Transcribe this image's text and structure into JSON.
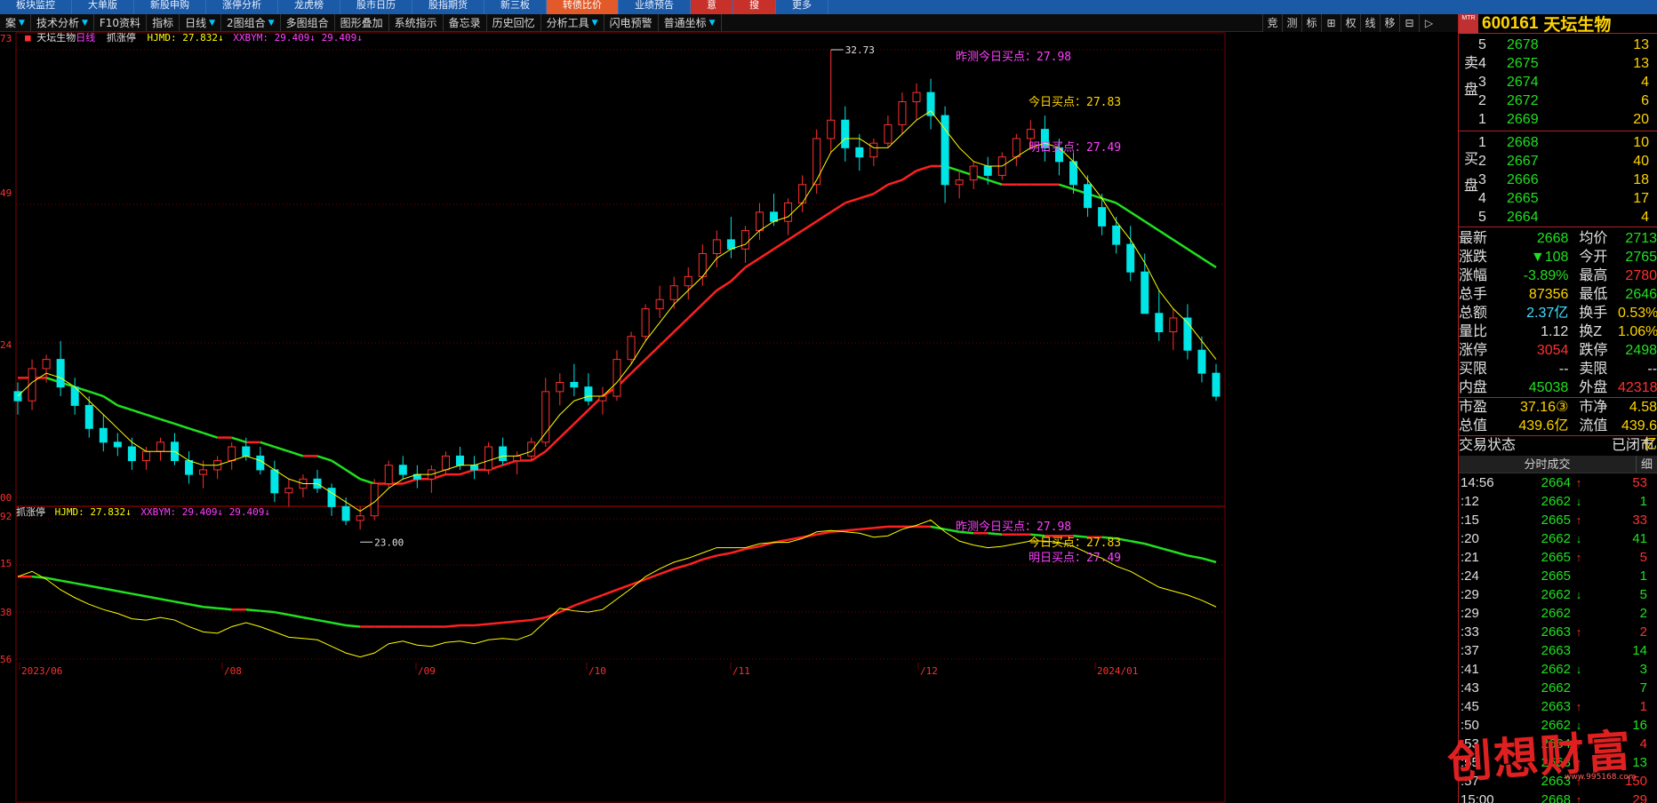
{
  "topmenu": [
    {
      "label": "板块监控",
      "hl": ""
    },
    {
      "label": "大单版",
      "hl": ""
    },
    {
      "label": "新股申购",
      "hl": ""
    },
    {
      "label": "涨停分析",
      "hl": ""
    },
    {
      "label": "龙虎榜",
      "hl": ""
    },
    {
      "label": "股市日历",
      "hl": ""
    },
    {
      "label": "股指期货",
      "hl": ""
    },
    {
      "label": "新三板",
      "hl": ""
    },
    {
      "label": "转债比价",
      "hl": "hl"
    },
    {
      "label": "业绩预告",
      "hl": ""
    },
    {
      "label": "意",
      "hl": "hl2"
    },
    {
      "label": "搜",
      "hl": "hl2"
    },
    {
      "label": "更多",
      "hl": ""
    }
  ],
  "toolbar": [
    {
      "label": "案",
      "dd": "▼"
    },
    {
      "label": "技术分析",
      "dd": "▼"
    },
    {
      "label": "F10资料",
      "dd": ""
    },
    {
      "label": "指标",
      "dd": ""
    },
    {
      "label": "日线",
      "dd": "▼"
    },
    {
      "label": "2图组合",
      "dd": "▼"
    },
    {
      "label": "多图组合",
      "dd": ""
    },
    {
      "label": "图形叠加",
      "dd": ""
    },
    {
      "label": "系统指示",
      "dd": ""
    },
    {
      "label": "备忘录",
      "dd": ""
    },
    {
      "label": "历史回忆",
      "dd": ""
    },
    {
      "label": "分析工具",
      "dd": "▼"
    },
    {
      "label": "闪电预警",
      "dd": ""
    },
    {
      "label": "普通坐标",
      "dd": "▼"
    }
  ],
  "rtools": [
    "竞",
    "测",
    "标",
    "⊞",
    "权",
    "线",
    "移",
    "⊟",
    "▷"
  ],
  "colors": {
    "up": "#ff3030",
    "down": "#00e5e5",
    "ma": "#ffff00",
    "pink": "#ff40ff",
    "green": "#20e020",
    "red": "#ff2020",
    "grid": "#7a0000",
    "price_text": "#20e020"
  },
  "main_info": {
    "name": "天坛生物",
    "period": "日线",
    "ind": "抓涨停",
    "hjmd": "HJMD: 27.832↓",
    "xxbym": "XXBYM: 29.409↓",
    "xxbym2": "29.409↓"
  },
  "sub_info": {
    "ind": "抓涨停",
    "hjmd": "HJMD: 27.832↓",
    "xxbym": "XXBYM: 29.409↓",
    "xxbym2": "29.409↓"
  },
  "annotations": {
    "max_label": "32.73",
    "min_label": "23.00",
    "buy_yday": "昨测今日买点：27.98",
    "buy_today": "今日买点：27.83",
    "buy_tomorrow": "明日买点：27.49"
  },
  "y_labels_main": [
    "73",
    "49",
    "24",
    "00"
  ],
  "y_labels_sub": [
    "92",
    "15",
    "38",
    "56"
  ],
  "x_labels": [
    "2023/06",
    "/08",
    "/09",
    "/10",
    "/11",
    "/12",
    "2024/01"
  ],
  "chart_data": {
    "type": "candlestick",
    "ylim": [
      23.0,
      32.73
    ],
    "candles": [
      [
        25.3,
        25.5,
        24.8,
        25.1
      ],
      [
        25.1,
        26.0,
        24.9,
        25.8
      ],
      [
        25.8,
        26.1,
        25.5,
        26.0
      ],
      [
        26.0,
        26.4,
        25.2,
        25.4
      ],
      [
        25.4,
        25.6,
        24.8,
        25.0
      ],
      [
        25.0,
        25.2,
        24.3,
        24.5
      ],
      [
        24.5,
        24.8,
        24.0,
        24.2
      ],
      [
        24.2,
        24.4,
        23.9,
        24.1
      ],
      [
        24.1,
        24.3,
        23.6,
        23.8
      ],
      [
        23.8,
        24.1,
        23.6,
        24.0
      ],
      [
        24.0,
        24.3,
        23.8,
        24.2
      ],
      [
        24.2,
        24.4,
        23.7,
        23.8
      ],
      [
        23.8,
        24.0,
        23.3,
        23.5
      ],
      [
        23.5,
        23.8,
        23.2,
        23.6
      ],
      [
        23.6,
        23.9,
        23.4,
        23.8
      ],
      [
        23.8,
        24.2,
        23.6,
        24.1
      ],
      [
        24.1,
        24.3,
        23.8,
        23.9
      ],
      [
        23.9,
        24.1,
        23.5,
        23.6
      ],
      [
        23.6,
        23.8,
        22.9,
        23.1
      ],
      [
        23.1,
        23.4,
        22.8,
        23.2
      ],
      [
        23.2,
        23.5,
        23.0,
        23.4
      ],
      [
        23.4,
        23.6,
        23.1,
        23.2
      ],
      [
        23.2,
        23.3,
        22.6,
        22.8
      ],
      [
        22.8,
        23.0,
        22.4,
        22.5
      ],
      [
        22.5,
        22.8,
        22.3,
        22.6
      ],
      [
        22.6,
        23.4,
        22.5,
        23.3
      ],
      [
        23.3,
        23.8,
        23.2,
        23.7
      ],
      [
        23.7,
        23.9,
        23.4,
        23.5
      ],
      [
        23.5,
        23.7,
        23.2,
        23.4
      ],
      [
        23.4,
        23.7,
        23.1,
        23.6
      ],
      [
        23.6,
        24.0,
        23.5,
        23.9
      ],
      [
        23.9,
        24.1,
        23.6,
        23.7
      ],
      [
        23.7,
        23.9,
        23.4,
        23.6
      ],
      [
        23.6,
        24.2,
        23.5,
        24.1
      ],
      [
        24.1,
        24.3,
        23.7,
        23.8
      ],
      [
        23.8,
        24.0,
        23.5,
        23.9
      ],
      [
        23.9,
        24.3,
        23.8,
        24.2
      ],
      [
        24.2,
        25.6,
        24.1,
        25.3
      ],
      [
        25.3,
        25.7,
        25.0,
        25.5
      ],
      [
        25.5,
        25.9,
        25.2,
        25.4
      ],
      [
        25.4,
        25.7,
        25.0,
        25.1
      ],
      [
        25.1,
        25.4,
        24.8,
        25.2
      ],
      [
        25.2,
        26.2,
        25.1,
        26.0
      ],
      [
        26.0,
        26.6,
        25.9,
        26.5
      ],
      [
        26.5,
        27.2,
        26.4,
        27.1
      ],
      [
        27.1,
        27.6,
        26.9,
        27.3
      ],
      [
        27.3,
        27.8,
        27.1,
        27.6
      ],
      [
        27.6,
        28.0,
        27.3,
        27.8
      ],
      [
        27.8,
        28.5,
        27.6,
        28.3
      ],
      [
        28.3,
        28.8,
        28.0,
        28.6
      ],
      [
        28.6,
        29.1,
        28.2,
        28.4
      ],
      [
        28.4,
        28.9,
        28.1,
        28.8
      ],
      [
        28.8,
        29.4,
        28.6,
        29.2
      ],
      [
        29.2,
        29.6,
        28.9,
        29.0
      ],
      [
        29.0,
        29.5,
        28.7,
        29.4
      ],
      [
        29.4,
        30.0,
        29.2,
        29.8
      ],
      [
        29.8,
        31.0,
        29.6,
        30.8
      ],
      [
        30.8,
        32.73,
        30.5,
        31.2
      ],
      [
        31.2,
        31.5,
        30.3,
        30.6
      ],
      [
        30.6,
        30.9,
        30.1,
        30.4
      ],
      [
        30.4,
        30.8,
        30.2,
        30.7
      ],
      [
        30.7,
        31.3,
        30.6,
        31.1
      ],
      [
        31.1,
        31.8,
        30.9,
        31.6
      ],
      [
        31.6,
        32.0,
        31.2,
        31.8
      ],
      [
        31.8,
        32.1,
        31.0,
        31.3
      ],
      [
        31.3,
        31.5,
        29.4,
        29.8
      ],
      [
        29.8,
        30.1,
        29.5,
        29.9
      ],
      [
        29.9,
        30.3,
        29.7,
        30.2
      ],
      [
        30.2,
        30.4,
        29.8,
        30.0
      ],
      [
        30.0,
        30.5,
        29.9,
        30.4
      ],
      [
        30.4,
        30.9,
        30.2,
        30.8
      ],
      [
        30.8,
        31.2,
        30.6,
        31.0
      ],
      [
        31.0,
        31.3,
        30.3,
        30.6
      ],
      [
        30.6,
        30.8,
        30.0,
        30.3
      ],
      [
        30.3,
        30.5,
        29.6,
        29.8
      ],
      [
        29.8,
        30.0,
        29.1,
        29.3
      ],
      [
        29.3,
        29.6,
        28.7,
        28.9
      ],
      [
        28.9,
        29.1,
        28.3,
        28.5
      ],
      [
        28.5,
        28.9,
        27.7,
        27.9
      ],
      [
        27.9,
        28.3,
        27.2,
        27.0
      ],
      [
        27.0,
        27.5,
        26.4,
        26.6
      ],
      [
        26.6,
        27.1,
        26.2,
        26.9
      ],
      [
        26.9,
        27.2,
        26.0,
        26.2
      ],
      [
        26.2,
        26.5,
        25.5,
        25.7
      ],
      [
        25.7,
        25.9,
        25.1,
        25.2
      ]
    ],
    "ma": [
      25.2,
      25.5,
      25.7,
      25.6,
      25.4,
      25.1,
      24.8,
      24.5,
      24.2,
      24.0,
      24.0,
      24.0,
      23.8,
      23.7,
      23.7,
      23.8,
      23.9,
      23.8,
      23.6,
      23.4,
      23.3,
      23.3,
      23.1,
      22.9,
      22.7,
      22.9,
      23.2,
      23.4,
      23.5,
      23.5,
      23.6,
      23.7,
      23.7,
      23.8,
      23.9,
      23.9,
      24.0,
      24.4,
      24.8,
      25.1,
      25.2,
      25.2,
      25.5,
      25.9,
      26.4,
      26.8,
      27.2,
      27.5,
      27.8,
      28.2,
      28.4,
      28.5,
      28.8,
      29.0,
      29.1,
      29.4,
      29.9,
      30.5,
      30.8,
      30.8,
      30.6,
      30.6,
      30.9,
      31.2,
      31.4,
      31.0,
      30.6,
      30.3,
      30.2,
      30.2,
      30.4,
      30.6,
      30.7,
      30.6,
      30.3,
      29.9,
      29.5,
      29.0,
      28.6,
      28.1,
      27.5,
      27.1,
      26.8,
      26.4,
      26.0
    ],
    "line_slow": [
      25.6,
      25.6,
      25.6,
      25.5,
      25.4,
      25.3,
      25.2,
      25.0,
      24.9,
      24.8,
      24.7,
      24.6,
      24.5,
      24.4,
      24.3,
      24.3,
      24.2,
      24.2,
      24.1,
      24.0,
      23.9,
      23.9,
      23.8,
      23.6,
      23.4,
      23.3,
      23.3,
      23.3,
      23.4,
      23.4,
      23.5,
      23.5,
      23.6,
      23.6,
      23.7,
      23.8,
      23.8,
      24.0,
      24.3,
      24.6,
      24.9,
      25.2,
      25.4,
      25.7,
      26.0,
      26.3,
      26.6,
      26.9,
      27.2,
      27.5,
      27.7,
      28.0,
      28.2,
      28.4,
      28.6,
      28.8,
      29.0,
      29.2,
      29.4,
      29.5,
      29.6,
      29.8,
      29.9,
      30.1,
      30.2,
      30.2,
      30.1,
      30.0,
      29.9,
      29.8,
      29.8,
      29.8,
      29.8,
      29.8,
      29.7,
      29.6,
      29.5,
      29.4,
      29.2,
      29.0,
      28.8,
      28.6,
      28.4,
      28.2,
      28.0
    ],
    "sub_yellow": [
      0.66,
      0.7,
      0.64,
      0.56,
      0.5,
      0.45,
      0.41,
      0.38,
      0.34,
      0.33,
      0.35,
      0.33,
      0.28,
      0.24,
      0.23,
      0.28,
      0.31,
      0.28,
      0.24,
      0.2,
      0.19,
      0.18,
      0.13,
      0.08,
      0.05,
      0.08,
      0.15,
      0.17,
      0.14,
      0.13,
      0.16,
      0.17,
      0.15,
      0.18,
      0.19,
      0.18,
      0.22,
      0.32,
      0.42,
      0.4,
      0.39,
      0.41,
      0.49,
      0.57,
      0.66,
      0.72,
      0.77,
      0.8,
      0.84,
      0.88,
      0.88,
      0.88,
      0.91,
      0.92,
      0.92,
      0.95,
      1.0,
      1.01,
      1.0,
      0.99,
      0.96,
      0.97,
      1.02,
      1.05,
      1.09,
      1.0,
      0.93,
      0.9,
      0.88,
      0.89,
      0.91,
      0.93,
      0.93,
      0.92,
      0.89,
      0.84,
      0.8,
      0.74,
      0.7,
      0.64,
      0.58,
      0.55,
      0.52,
      0.48,
      0.43
    ],
    "sub_trend": [
      0.66,
      0.66,
      0.65,
      0.63,
      0.61,
      0.59,
      0.57,
      0.55,
      0.53,
      0.51,
      0.49,
      0.47,
      0.45,
      0.43,
      0.42,
      0.41,
      0.41,
      0.4,
      0.39,
      0.37,
      0.35,
      0.33,
      0.31,
      0.29,
      0.28,
      0.28,
      0.28,
      0.28,
      0.28,
      0.28,
      0.28,
      0.29,
      0.29,
      0.3,
      0.31,
      0.32,
      0.33,
      0.35,
      0.39,
      0.44,
      0.48,
      0.52,
      0.56,
      0.6,
      0.64,
      0.68,
      0.72,
      0.75,
      0.79,
      0.82,
      0.84,
      0.87,
      0.89,
      0.92,
      0.94,
      0.96,
      0.98,
      1.0,
      1.01,
      1.02,
      1.03,
      1.04,
      1.04,
      1.04,
      1.04,
      1.02,
      1.0,
      0.99,
      0.99,
      0.98,
      0.98,
      0.98,
      0.97,
      0.97,
      0.97,
      0.96,
      0.96,
      0.95,
      0.93,
      0.91,
      0.88,
      0.85,
      0.82,
      0.8,
      0.77
    ]
  },
  "stock": {
    "code": "600161",
    "name": "天坛生物",
    "mtr": "MTR"
  },
  "sell_side": "卖盘",
  "buy_side": "买盘",
  "sells": [
    {
      "lv": "5",
      "px": "2678",
      "vol": "13"
    },
    {
      "lv": "4",
      "px": "2675",
      "vol": "13"
    },
    {
      "lv": "3",
      "px": "2674",
      "vol": "4"
    },
    {
      "lv": "2",
      "px": "2672",
      "vol": "6"
    },
    {
      "lv": "1",
      "px": "2669",
      "vol": "20"
    }
  ],
  "buys": [
    {
      "lv": "1",
      "px": "2668",
      "vol": "10"
    },
    {
      "lv": "2",
      "px": "2667",
      "vol": "40"
    },
    {
      "lv": "3",
      "px": "2666",
      "vol": "18"
    },
    {
      "lv": "4",
      "px": "2665",
      "vol": "17"
    },
    {
      "lv": "5",
      "px": "2664",
      "vol": "4"
    }
  ],
  "quote": [
    {
      "k": "最新",
      "v": "2668",
      "vc": "#20e020",
      "k2": "均价",
      "v2": "2713",
      "v2c": "#20e020"
    },
    {
      "k": "涨跌",
      "v": "▼108",
      "vc": "#20e020",
      "k2": "今开",
      "v2": "2765",
      "v2c": "#20e020"
    },
    {
      "k": "涨幅",
      "v": "-3.89%",
      "vc": "#20e020",
      "k2": "最高",
      "v2": "2780",
      "v2c": "#ff3030"
    },
    {
      "k": "总手",
      "v": "87356",
      "vc": "#ffd400",
      "k2": "最低",
      "v2": "2646",
      "v2c": "#20e020"
    },
    {
      "k": "总额",
      "v": "2.37亿",
      "vc": "#40e0ff",
      "k2": "换手",
      "v2": "0.53%",
      "v2c": "#ffd400"
    },
    {
      "k": "量比",
      "v": "1.12",
      "vc": "#e0e0e0",
      "k2": "换Z",
      "v2": "1.06%",
      "v2c": "#ffd400"
    },
    {
      "k": "涨停",
      "v": "3054",
      "vc": "#ff3030",
      "k2": "跌停",
      "v2": "2498",
      "v2c": "#20e020"
    },
    {
      "k": "买限",
      "v": "--",
      "vc": "#e0e0e0",
      "k2": "卖限",
      "v2": "--",
      "v2c": "#e0e0e0"
    },
    {
      "k": "内盘",
      "v": "45038",
      "vc": "#20e020",
      "k2": "外盘",
      "v2": "42318",
      "v2c": "#ff3030"
    }
  ],
  "quote2": [
    {
      "k": "市盈",
      "v": "37.16③",
      "vc": "#ffd400",
      "k2": "市净",
      "v2": "4.58",
      "v2c": "#ffd400"
    },
    {
      "k": "总值",
      "v": "439.6亿",
      "vc": "#ffd400",
      "k2": "流值",
      "v2": "439.6亿",
      "v2c": "#ffd400"
    }
  ],
  "trade_status": {
    "k": "交易状态",
    "v": "已闭市"
  },
  "trades_head": {
    "title": "分时成交",
    "detail": "细"
  },
  "trades": [
    {
      "t": "14:56",
      "p": "2664",
      "a": "↑",
      "ac": "#ff3030",
      "n": "53",
      "nc": "#ff3030"
    },
    {
      "t": ":12",
      "p": "2662",
      "a": "↓",
      "ac": "#20e020",
      "n": "1",
      "nc": "#20e020"
    },
    {
      "t": ":15",
      "p": "2665",
      "a": "↑",
      "ac": "#ff3030",
      "n": "33",
      "nc": "#ff3030"
    },
    {
      "t": ":20",
      "p": "2662",
      "a": "↓",
      "ac": "#20e020",
      "n": "41",
      "nc": "#20e020"
    },
    {
      "t": ":21",
      "p": "2665",
      "a": "↑",
      "ac": "#ff3030",
      "n": "5",
      "nc": "#ff3030"
    },
    {
      "t": ":24",
      "p": "2665",
      "a": "",
      "ac": "#e0e0e0",
      "n": "1",
      "nc": "#20e020"
    },
    {
      "t": ":29",
      "p": "2662",
      "a": "↓",
      "ac": "#20e020",
      "n": "5",
      "nc": "#20e020"
    },
    {
      "t": ":29",
      "p": "2662",
      "a": "",
      "ac": "#e0e0e0",
      "n": "2",
      "nc": "#20e020"
    },
    {
      "t": ":33",
      "p": "2663",
      "a": "↑",
      "ac": "#ff3030",
      "n": "2",
      "nc": "#ff3030"
    },
    {
      "t": ":37",
      "p": "2663",
      "a": "",
      "ac": "#e0e0e0",
      "n": "14",
      "nc": "#20e020"
    },
    {
      "t": ":41",
      "p": "2662",
      "a": "↓",
      "ac": "#20e020",
      "n": "3",
      "nc": "#20e020"
    },
    {
      "t": ":43",
      "p": "2662",
      "a": "",
      "ac": "#e0e0e0",
      "n": "7",
      "nc": "#20e020"
    },
    {
      "t": ":45",
      "p": "2663",
      "a": "↑",
      "ac": "#ff3030",
      "n": "1",
      "nc": "#ff3030"
    },
    {
      "t": ":50",
      "p": "2662",
      "a": "↓",
      "ac": "#20e020",
      "n": "16",
      "nc": "#20e020"
    },
    {
      "t": ":53",
      "p": "2664",
      "a": "↑",
      "ac": "#ff3030",
      "n": "4",
      "nc": "#ff3030"
    },
    {
      "t": ":55",
      "p": "2663",
      "a": "↑",
      "ac": "#ff3030",
      "n": "13",
      "nc": "#20e020"
    },
    {
      "t": ":57",
      "p": "2663",
      "a": "↑",
      "ac": "#ff3030",
      "n": "150",
      "nc": "#ff3030"
    },
    {
      "t": "15:00",
      "p": "2668",
      "a": "↑",
      "ac": "#ff3030",
      "n": "29",
      "nc": "#ff3030"
    }
  ],
  "watermark": {
    "text": "创想财富",
    "url": "www.995168.com"
  }
}
